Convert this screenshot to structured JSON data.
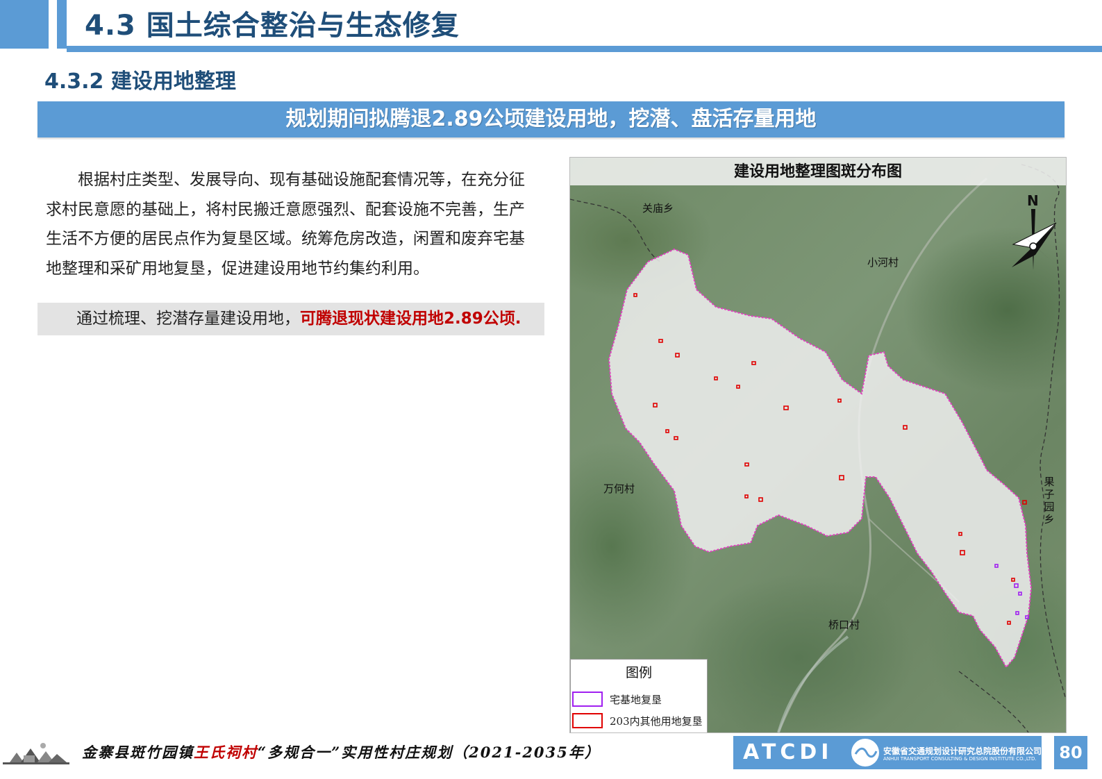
{
  "header": {
    "title": "4.3 国土综合整治与生态修复"
  },
  "subtitle": "4.3.2 建设用地整理",
  "banner": "规划期间拟腾退2.89公顷建设用地，挖潜、盘活存量用地",
  "body": {
    "paragraph": "根据村庄类型、发展导向、现有基础设施配套情况等，在充分征求村民意愿的基础上，将村民搬迁意愿强烈、配套设施不完善，生产生活不方便的居民点作为复垦区域。统筹危房改造，闲置和废弃宅基地整理和采矿用地复垦，促进建设用地节约集约利用。",
    "highlight_prefix": "通过梳理、挖潜存量建设用地，",
    "highlight_emphasis": "可腾退现状建设用地2.89公顷."
  },
  "map": {
    "title": "建设用地整理图斑分布图",
    "north": "N",
    "places": {
      "guanmiao": "关庙乡",
      "xiaohe": "小河村",
      "wanhe": "万何村",
      "guoziyuan": "果子园乡",
      "qiaokou": "桥口村"
    },
    "legend": {
      "title": "图例",
      "items": [
        {
          "label": "宅基地复垦",
          "color": "#a020f0"
        },
        {
          "label": "203内其他用地复垦",
          "color": "#e00000"
        }
      ]
    },
    "colors": {
      "boundary": "#e040c0",
      "residential_patch": "#a020f0",
      "other_patch": "#e00000"
    }
  },
  "footer": {
    "prefix": "金寨县斑竹园镇",
    "village": "王氏祠村",
    "suffix": "“多规合一”实用性村庄规划（2021-2035年）",
    "company_logo": "ATCDI",
    "company_cn": "安徽省交通规划设计研究总院股份有限公司",
    "company_en": "ANHUI TRANSPORT CONSULTING & DESIGN INSTITUTE CO.,LTD.",
    "page": "80"
  }
}
